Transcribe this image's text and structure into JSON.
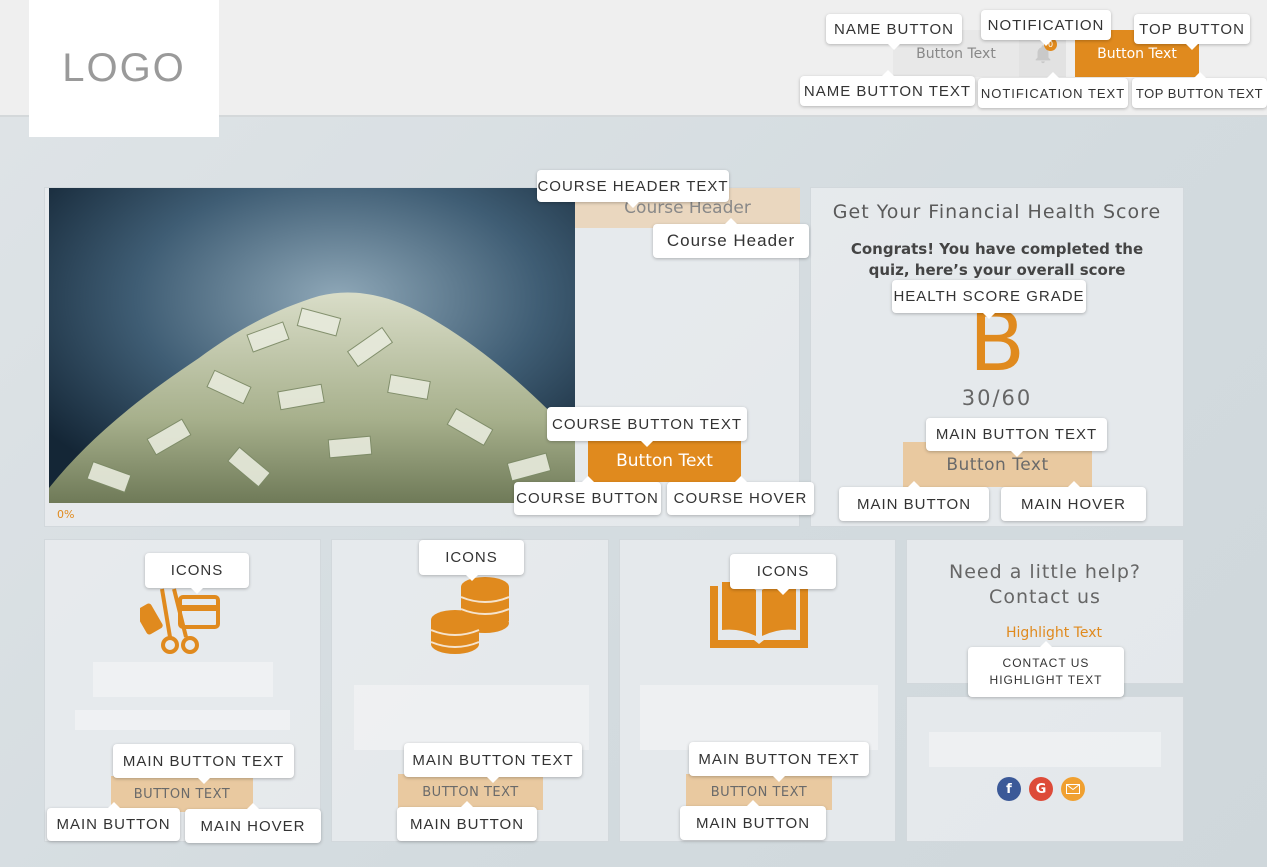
{
  "header": {
    "logo_text": "LOGO",
    "name_button_text": "Button Text",
    "notification_count": "0",
    "top_button_text": "Button Text"
  },
  "course": {
    "header_text": "Course Header",
    "progress_text": "0%",
    "button_text": "Button Text"
  },
  "score": {
    "title": "Get Your Financial Health Score",
    "message": "Congrats! You have completed the quiz, here’s your overall score",
    "grade": "B",
    "points": "30/60",
    "button_text": "Button Text"
  },
  "cards": [
    {
      "icon": "beauty-shopping-icon",
      "button_text": "BUTTON TEXT"
    },
    {
      "icon": "coins-icon",
      "button_text": "BUTTON TEXT"
    },
    {
      "icon": "book-icon",
      "button_text": "BUTTON TEXT"
    }
  ],
  "help": {
    "title_line1": "Need a little help?",
    "title_line2": "Contact us",
    "highlight_text": "Highlight Text"
  },
  "social": [
    "facebook-icon",
    "google-icon",
    "email-icon"
  ],
  "callouts": {
    "name_button": "NAME BUTTON",
    "notification": "NOTIFICATION",
    "top_button": "TOP BUTTON",
    "name_button_text": "NAME BUTTON TEXT",
    "notification_text": "NOTIFICATION TEXT",
    "top_button_text": "TOP BUTTON TEXT",
    "course_header_text": "COURSE HEADER TEXT",
    "course_header": "Course Header",
    "health_score_grade": "HEALTH SCORE GRADE",
    "course_button_text": "COURSE BUTTON TEXT",
    "main_button_text": "MAIN BUTTON TEXT",
    "course_button": "COURSE BUTTON",
    "course_hover": "COURSE HOVER",
    "main_button": "MAIN BUTTON",
    "main_hover": "MAIN HOVER",
    "icons": "ICONS",
    "contact_us_highlight_text": "CONTACT US\nHIGHLIGHT TEXT"
  },
  "colors": {
    "accent": "#e08a1e",
    "button_muted": "#e9c9a0",
    "facebook": "#3b5998",
    "google": "#dd4b39",
    "email": "#f0a030"
  }
}
